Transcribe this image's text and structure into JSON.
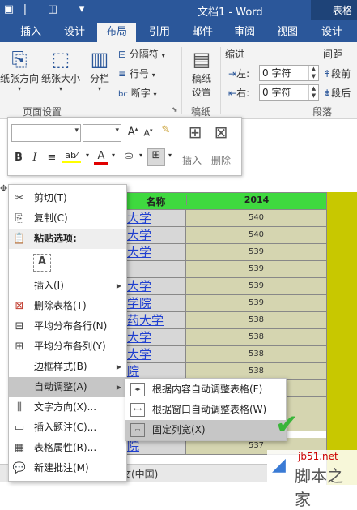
{
  "titlebar": {
    "doc_title": "文档1 - Word",
    "right_title": "表格"
  },
  "tabs": [
    {
      "label": "插入"
    },
    {
      "label": "设计"
    },
    {
      "label": "布局"
    },
    {
      "label": "引用"
    },
    {
      "label": "邮件"
    },
    {
      "label": "审阅"
    },
    {
      "label": "视图"
    },
    {
      "label": "设计"
    }
  ],
  "ribbon": {
    "orientation": "纸张方向",
    "size": "纸张大小",
    "columns": "分栏",
    "breaks": "分隔符",
    "line_numbers": "行号",
    "hyphenation": "断字",
    "page_setup": "页面设置",
    "manuscript_line1": "稿纸",
    "manuscript_line2": "设置",
    "manuscript_group": "稿纸",
    "indent_title": "缩进",
    "left_label": "左:",
    "right_label": "右:",
    "left_value": "0 字符",
    "right_value": "0 字符",
    "spacing_title": "间距",
    "before_label": "段前",
    "after_label": "段后",
    "paragraph_group": "段落"
  },
  "minitoolbar": {
    "insert": "插入",
    "delete": "删除"
  },
  "table": {
    "header_name": "名称",
    "header_year": "2014",
    "rows": [
      {
        "name": "大学",
        "value": "540"
      },
      {
        "name": "大学",
        "value": "540"
      },
      {
        "name": "大学",
        "value": "539"
      },
      {
        "name": "",
        "value": "539"
      },
      {
        "name": "大学",
        "value": "539"
      },
      {
        "name": "学院",
        "value": "539"
      },
      {
        "name": "药大学",
        "value": "538"
      },
      {
        "name": "大学",
        "value": "538"
      },
      {
        "name": "大学",
        "value": "538"
      },
      {
        "name": "院",
        "value": "538"
      },
      {
        "name": "",
        "value": ""
      },
      {
        "name": "",
        "value": ""
      },
      {
        "name": "",
        "value": ""
      },
      {
        "name": "院",
        "value": "537"
      }
    ],
    "status_lang": "文(中国)"
  },
  "contextmenu": {
    "items": [
      {
        "label": "剪切(T)",
        "icon": "scissors-icon"
      },
      {
        "label": "复制(C)",
        "icon": "copy-icon"
      },
      {
        "label": "粘贴选项:",
        "icon": "paste-icon"
      },
      {
        "label": "",
        "icon": "paste-text-icon"
      },
      {
        "label": "插入(I)",
        "icon": ""
      },
      {
        "label": "删除表格(T)",
        "icon": "delete-table-icon"
      },
      {
        "label": "平均分布各行(N)",
        "icon": "distribute-rows-icon"
      },
      {
        "label": "平均分布各列(Y)",
        "icon": "distribute-columns-icon"
      },
      {
        "label": "边框样式(B)",
        "icon": ""
      },
      {
        "label": "自动调整(A)",
        "icon": ""
      },
      {
        "label": "文字方向(X)...",
        "icon": "text-direction-icon"
      },
      {
        "label": "插入题注(C)...",
        "icon": "caption-icon"
      },
      {
        "label": "表格属性(R)...",
        "icon": "table-properties-icon"
      },
      {
        "label": "新建批注(M)",
        "icon": "comment-icon"
      }
    ]
  },
  "submenu": {
    "items": [
      {
        "label": "根据内容自动调整表格(F)"
      },
      {
        "label": "根据窗口自动调整表格(W)"
      },
      {
        "label": "固定列宽(X)"
      }
    ]
  },
  "watermark": {
    "site": "jb51.net",
    "brand": "脚本之家"
  },
  "colors": {
    "word_blue": "#2b579a",
    "header_green": "#3fd93f",
    "yellow_col": "#c8c800",
    "check_green": "#3ab53a"
  }
}
